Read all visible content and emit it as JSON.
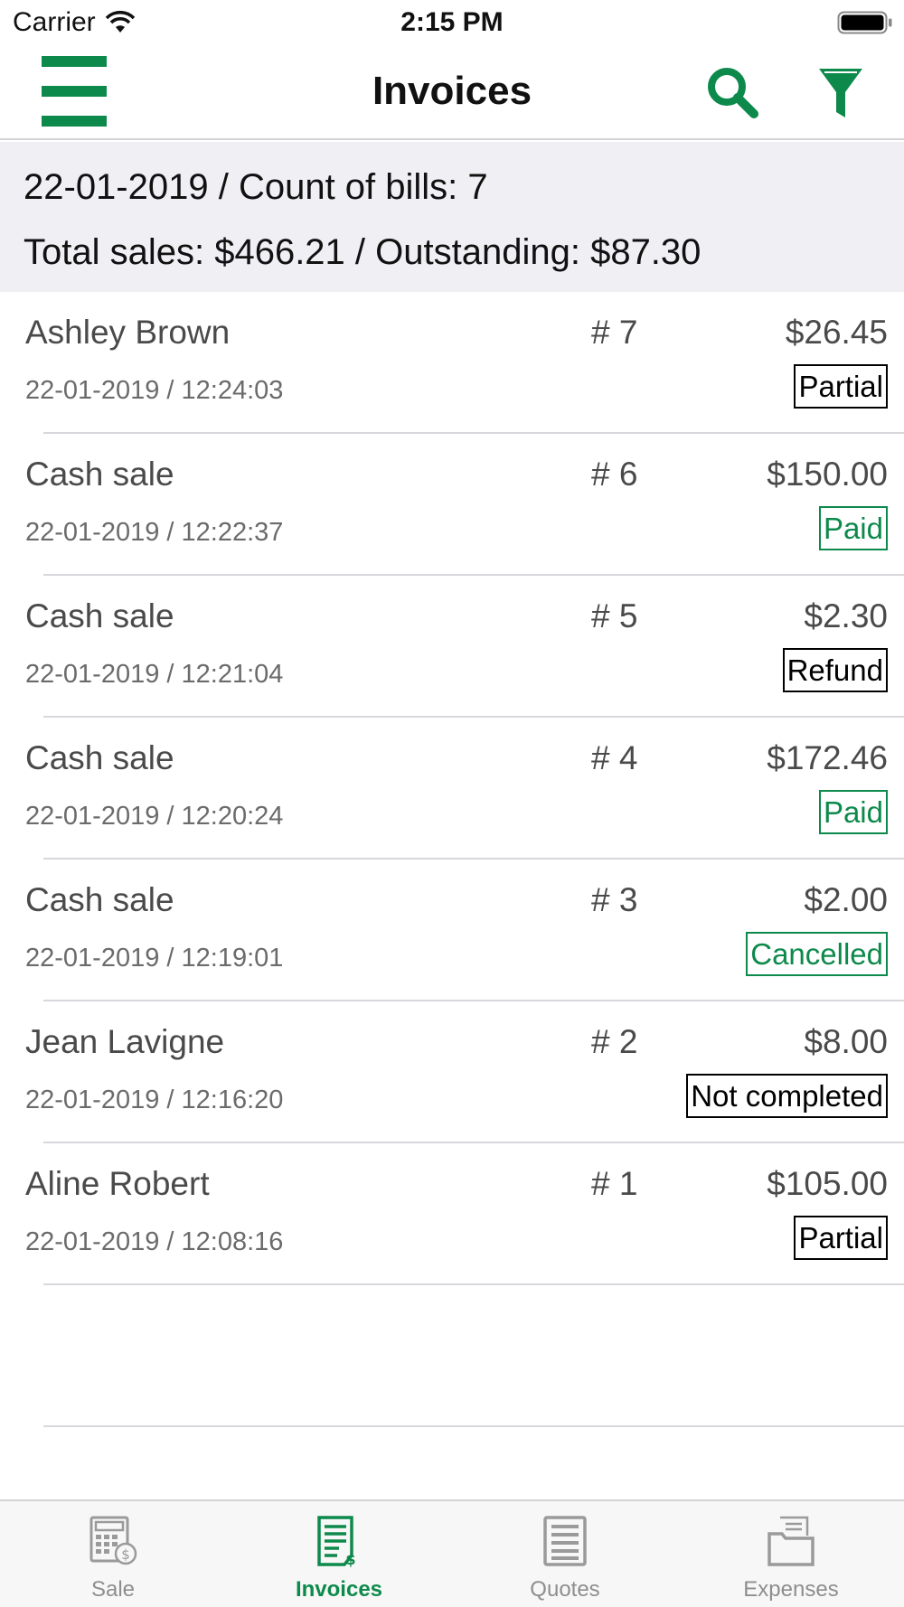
{
  "status_bar": {
    "carrier": "Carrier",
    "time": "2:15 PM"
  },
  "nav": {
    "title": "Invoices",
    "accent_color": "#0d8a4b",
    "icons": [
      "hamburger-menu-icon",
      "search-icon",
      "filter-icon"
    ]
  },
  "summary": {
    "line1": "22-01-2019 / Count of bills: 7",
    "line2": "Total sales: $466.21 / Outstanding: $87.30"
  },
  "invoices": [
    {
      "customer": "Ashley Brown",
      "datetime": "22-01-2019 / 12:24:03",
      "number": "# 7",
      "amount": "$26.45",
      "status": "Partial",
      "status_color": "#000000"
    },
    {
      "customer": "Cash sale",
      "datetime": "22-01-2019 / 12:22:37",
      "number": "# 6",
      "amount": "$150.00",
      "status": "Paid",
      "status_color": "#0d8a4b"
    },
    {
      "customer": "Cash sale",
      "datetime": "22-01-2019 / 12:21:04",
      "number": "# 5",
      "amount": "$2.30",
      "status": "Refund",
      "status_color": "#000000"
    },
    {
      "customer": "Cash sale",
      "datetime": "22-01-2019 / 12:20:24",
      "number": "# 4",
      "amount": "$172.46",
      "status": "Paid",
      "status_color": "#0d8a4b"
    },
    {
      "customer": "Cash sale",
      "datetime": "22-01-2019 / 12:19:01",
      "number": "# 3",
      "amount": "$2.00",
      "status": "Cancelled",
      "status_color": "#0d8a4b"
    },
    {
      "customer": "Jean Lavigne",
      "datetime": "22-01-2019 / 12:16:20",
      "number": "# 2",
      "amount": "$8.00",
      "status": "Not completed",
      "status_color": "#000000"
    },
    {
      "customer": "Aline Robert",
      "datetime": "22-01-2019 / 12:08:16",
      "number": "# 1",
      "amount": "$105.00",
      "status": "Partial",
      "status_color": "#000000"
    }
  ],
  "tabs": [
    {
      "label": "Sale",
      "icon": "calculator-icon",
      "active": false
    },
    {
      "label": "Invoices",
      "icon": "invoice-icon",
      "active": true
    },
    {
      "label": "Quotes",
      "icon": "quote-icon",
      "active": false
    },
    {
      "label": "Expenses",
      "icon": "expenses-folder-icon",
      "active": false
    }
  ]
}
